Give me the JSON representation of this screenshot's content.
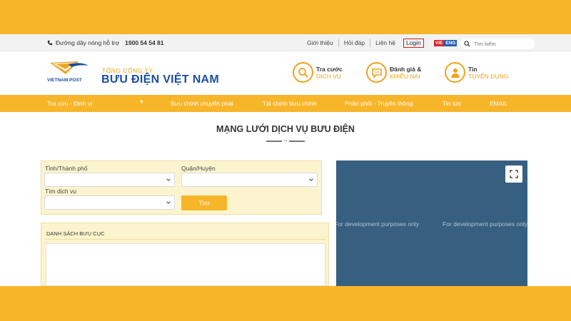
{
  "topbar": {
    "hotline_label": "Đường dây nóng hỗ trợ",
    "hotline_number": "1900 54 54 81",
    "links": [
      "Giới thiệu",
      "Hỏi đáp",
      "Liên hệ"
    ],
    "login": "Login",
    "lang_vi": "VIE",
    "lang_en": "ENG",
    "search_placeholder": "Tìm kiếm"
  },
  "header": {
    "logo_text": "VIETNAM POST",
    "brand_small": "TỔNG CÔNG TY",
    "brand_big": "BƯU ĐIỆN VIỆT NAM",
    "services": [
      {
        "line1": "Tra cước",
        "line2": "DỊCH VỤ",
        "icon": "search-icon"
      },
      {
        "line1": "Đánh giá &",
        "line2": "KHIẾU NẠI",
        "icon": "chat-icon"
      },
      {
        "line1": "Tin",
        "line2": "TUYỂN DỤNG",
        "icon": "user-icon"
      }
    ]
  },
  "nav": {
    "items": [
      "Tra cứu - Định vị",
      "Bưu chính chuyển phát",
      "Tài chính bưu chính",
      "Phân phối - Truyền thông",
      "Tin tức",
      "EMAIL"
    ],
    "dropdown_glyph": "▼"
  },
  "page": {
    "title": "MẠNG LƯỚI DỊCH VỤ BƯU ĐIỆN"
  },
  "form": {
    "province_label": "Tỉnh/Thành phố",
    "district_label": "Quận/Huyện",
    "service_label": "Tìm dịch vụ",
    "province_value": "",
    "district_value": "",
    "service_value": "",
    "submit_label": "Tìm"
  },
  "list": {
    "title": "DANH SÁCH BƯU CỤC"
  },
  "map": {
    "watermark": "For development purposes only"
  },
  "colors": {
    "accent": "#f7b52a",
    "brand_blue": "#1a4fa0",
    "map_bg": "#365f80"
  }
}
